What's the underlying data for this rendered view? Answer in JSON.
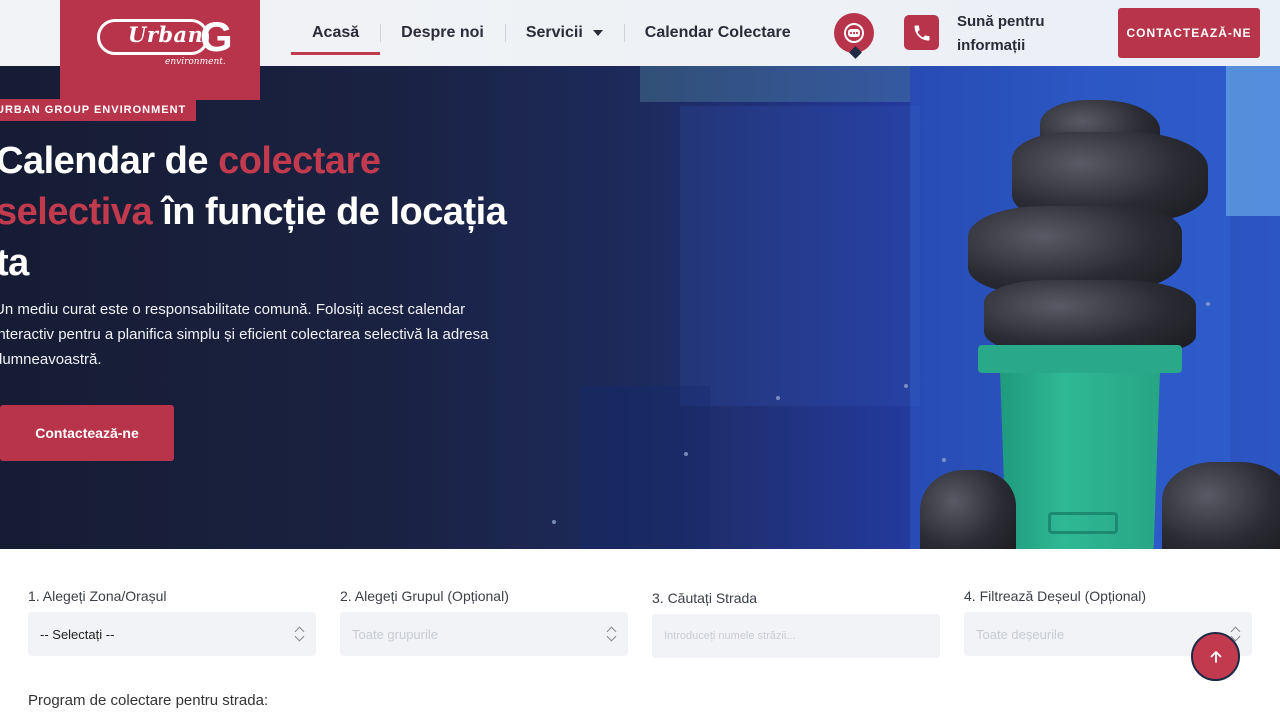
{
  "header": {
    "logo": {
      "name": "Urban",
      "subtitle": "environment."
    },
    "nav": [
      {
        "label": "Acasă",
        "active": true
      },
      {
        "label": "Despre noi",
        "active": false
      },
      {
        "label": "Servicii",
        "active": false,
        "has_dropdown": true
      },
      {
        "label": "Calendar Colectare",
        "active": false
      }
    ],
    "chat_icon": "chat-bubble-icon",
    "phone_icon": "phone-icon",
    "phone_text": "Sună pentru informații",
    "cta_label": "CONTACTEAZĂ-NE"
  },
  "hero": {
    "badge": "URBAN GROUP ENVIRONMENT",
    "title_part1": "Calendar de ",
    "title_accent": "colectare selectiva",
    "title_part2": " în funcție de locația ta",
    "description": "Un mediu curat este o responsabilitate comună. Folosiți acest calendar interactiv pentru a planifica simplu și eficient colectarea selectivă la adresa dumneavoastră.",
    "button_label": "Contactează-ne"
  },
  "filters": [
    {
      "label": "1. Alegeți Zona/Orașul",
      "value": "-- Selectați --",
      "type": "select"
    },
    {
      "label": "2. Alegeți Grupul (Opțional)",
      "value": "Toate grupurile",
      "type": "select"
    },
    {
      "label": "3. Căutați Strada",
      "placeholder": "Introduceți numele străzii...",
      "type": "input"
    },
    {
      "label": "4. Filtrează Deșeul (Opțional)",
      "value": "Toate deșeurile",
      "type": "select"
    }
  ],
  "program_heading": "Program de colectare pentru strada:",
  "colors": {
    "accent": "#b8344a",
    "hero_dark": "#161c33",
    "hero_blue": "#2c56c4",
    "bin_green": "#2aa88a"
  },
  "scroll_top_icon": "arrow-up-icon"
}
